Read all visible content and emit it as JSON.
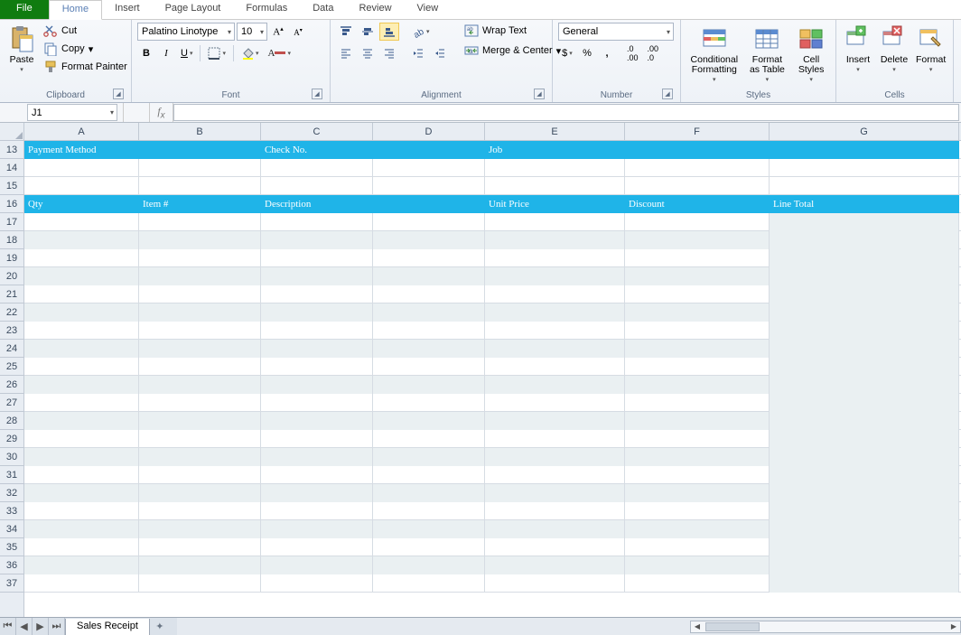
{
  "tabs": {
    "file": "File",
    "home": "Home",
    "insert": "Insert",
    "pageLayout": "Page Layout",
    "formulas": "Formulas",
    "data": "Data",
    "review": "Review",
    "view": "View"
  },
  "clipboard": {
    "paste": "Paste",
    "cut": "Cut",
    "copy": "Copy",
    "formatPainter": "Format Painter",
    "label": "Clipboard"
  },
  "font": {
    "name": "Palatino Linotype",
    "size": "10",
    "label": "Font"
  },
  "alignment": {
    "wrap": "Wrap Text",
    "merge": "Merge & Center",
    "label": "Alignment"
  },
  "number": {
    "format": "General",
    "label": "Number"
  },
  "styles": {
    "cond": "Conditional Formatting",
    "asTable": "Format as Table",
    "cellStyles": "Cell Styles",
    "label": "Styles"
  },
  "cellsGroup": {
    "insert": "Insert",
    "delete": "Delete",
    "format": "Format",
    "label": "Cells"
  },
  "nameBox": "J1",
  "columns": [
    "A",
    "B",
    "C",
    "D",
    "E",
    "F",
    "G"
  ],
  "rowStart": 13,
  "rowEnd": 37,
  "headerRow1": {
    "A": "Payment Method",
    "C": "Check No.",
    "E": "Job"
  },
  "headerRow2": {
    "A": "Qty",
    "B": "Item #",
    "C": "Description",
    "E": "Unit Price",
    "F": "Discount",
    "G": "Line Total"
  },
  "sheetName": "Sales Receipt"
}
